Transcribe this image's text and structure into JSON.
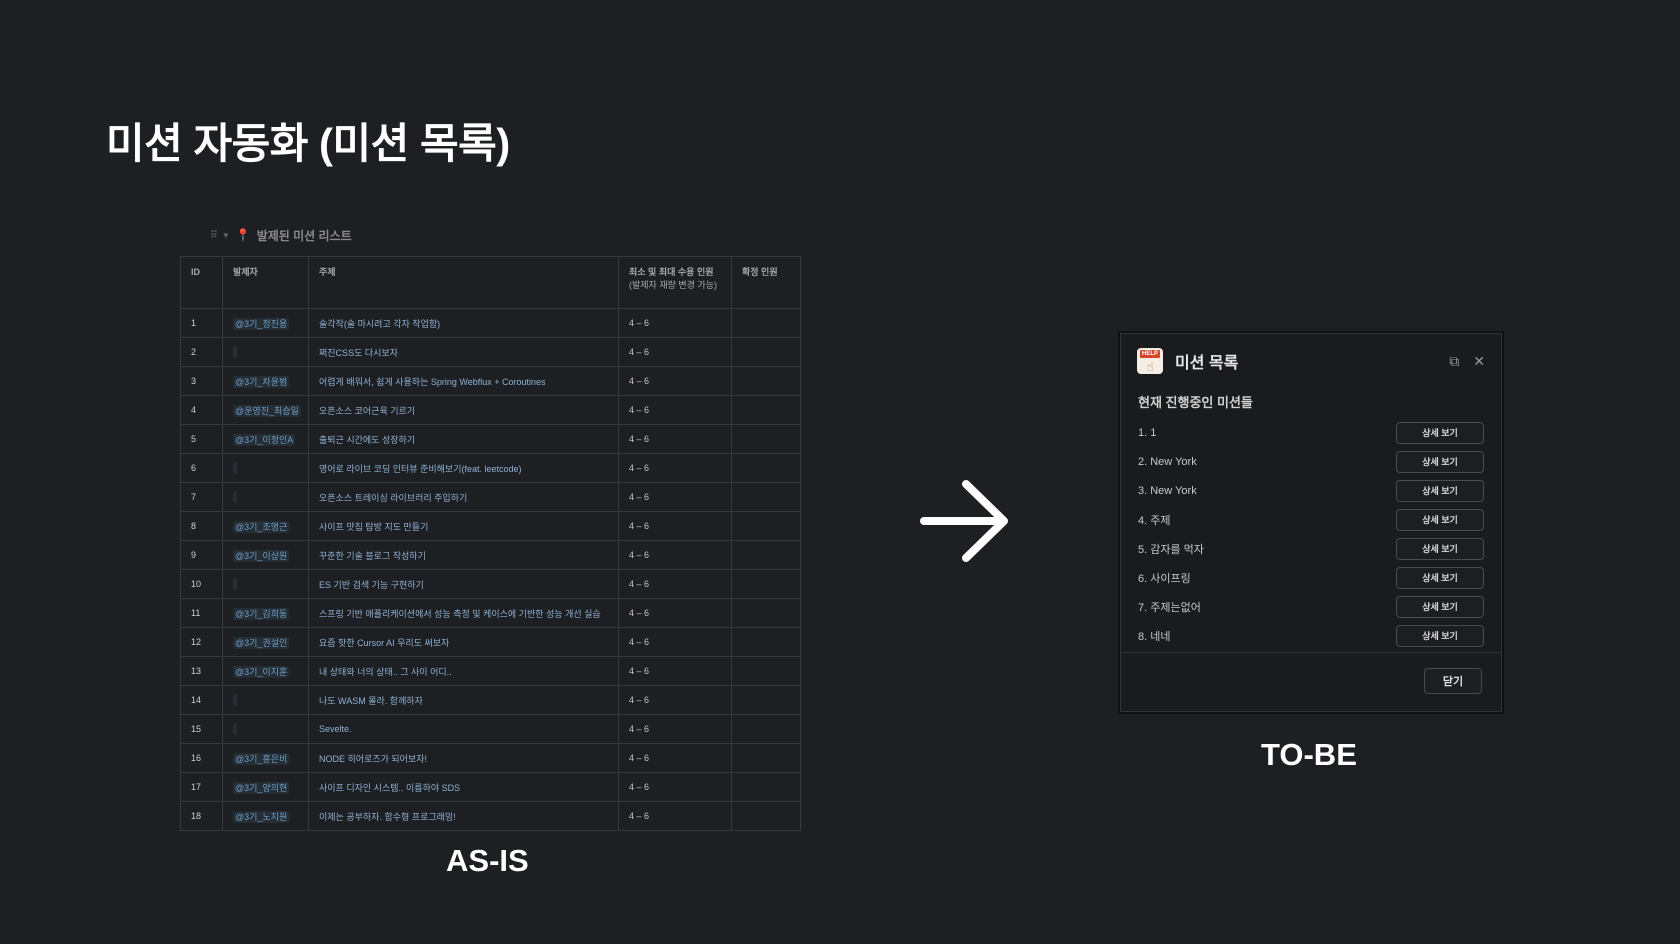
{
  "slide": {
    "title": "미션 자동화 (미션 목록)",
    "asis_label": "AS-IS",
    "tobe_label": "TO-BE"
  },
  "asis_table": {
    "heading": "발제된 미션 리스트",
    "columns": {
      "id": "ID",
      "author": "발제자",
      "topic": "주제",
      "range_line1": "최소 및 최대 수용 인원",
      "range_line2": "(발제자 재량 변경 가능)",
      "confirmed": "확정 인원"
    },
    "rows": [
      {
        "id": "1",
        "author": "@3기_정진용",
        "topic": "술각작(술 마시려고 각자 작업함)",
        "range": "4 – 6",
        "confirmed": ""
      },
      {
        "id": "2",
        "author": "",
        "topic": "쩌진CSS도 다시보자",
        "range": "4 – 6",
        "confirmed": ""
      },
      {
        "id": "3",
        "author": "@3기_차윤범",
        "topic": "어렵게 배워서, 쉽게 사용하는 Spring Webflux + Coroutines",
        "range": "4 – 6",
        "confirmed": ""
      },
      {
        "id": "4",
        "author": "@운영진_최승일",
        "topic": "오픈소스 코어근육 기르기",
        "range": "4 – 6",
        "confirmed": ""
      },
      {
        "id": "5",
        "author": "@3기_이정인A",
        "topic": "출퇴근 시간에도 성장하기",
        "range": "4 – 6",
        "confirmed": ""
      },
      {
        "id": "6",
        "author": "",
        "topic": "영어로 라이브 코딩 인터뷰 준비해보기(feat. leetcode)",
        "range": "4 – 6",
        "confirmed": ""
      },
      {
        "id": "7",
        "author": "",
        "topic": "오픈소스 트레이싱 라이브러리 주입하기",
        "range": "4 – 6",
        "confirmed": ""
      },
      {
        "id": "8",
        "author": "@3기_조명근",
        "topic": "사이프 맛집 탐방 지도 만들기",
        "range": "4 – 6",
        "confirmed": ""
      },
      {
        "id": "9",
        "author": "@3기_이상원",
        "topic": "꾸준한 기술 블로그 작성하기",
        "range": "4 – 6",
        "confirmed": ""
      },
      {
        "id": "10",
        "author": "",
        "topic": "ES 기반 검색 기능 구현하기",
        "range": "4 – 6",
        "confirmed": ""
      },
      {
        "id": "11",
        "author": "@3기_김희동",
        "topic": "스프링 기반 애플리케이션에서 성능 측정 및 케이스에 기반한 성능 개선 실습",
        "range": "4 – 6",
        "confirmed": ""
      },
      {
        "id": "12",
        "author": "@3기_권설인",
        "topic": "요즘 핫한 Cursor AI 우리도 써보자",
        "range": "4 – 6",
        "confirmed": ""
      },
      {
        "id": "13",
        "author": "@3기_이지훈",
        "topic": "내 상태와 너의 상태.. 그 사이 어디..",
        "range": "4 – 6",
        "confirmed": ""
      },
      {
        "id": "14",
        "author": "",
        "topic": "나도 WASM 몰라. 함께하자",
        "range": "4 – 6",
        "confirmed": ""
      },
      {
        "id": "15",
        "author": "",
        "topic": "Sevelte.",
        "range": "4 – 6",
        "confirmed": ""
      },
      {
        "id": "16",
        "author": "@3기_홍은비",
        "topic": "NODE 히어로즈가 되어보자!",
        "range": "4 – 6",
        "confirmed": ""
      },
      {
        "id": "17",
        "author": "@3기_양의현",
        "topic": "사이프 디자인 시스템.. 이름하야 SDS",
        "range": "4 – 6",
        "confirmed": ""
      },
      {
        "id": "18",
        "author": "@3기_노지원",
        "topic": "이제는 공부하자. 함수형 프로그래밍!",
        "range": "4 – 6",
        "confirmed": ""
      }
    ]
  },
  "modal": {
    "icon_badge": "HELP",
    "title": "미션 목록",
    "section_title": "현재 진행중인 미션들",
    "detail_button_label": "상세 보기",
    "close_button_label": "닫기",
    "missions": [
      {
        "name": "1. 1"
      },
      {
        "name": "2. New York"
      },
      {
        "name": "3. New York"
      },
      {
        "name": "4. 주제"
      },
      {
        "name": "5. 감자를 먹자"
      },
      {
        "name": "6. 사이프링"
      },
      {
        "name": "7. 주제는없어"
      },
      {
        "name": "8. 네네"
      }
    ]
  }
}
